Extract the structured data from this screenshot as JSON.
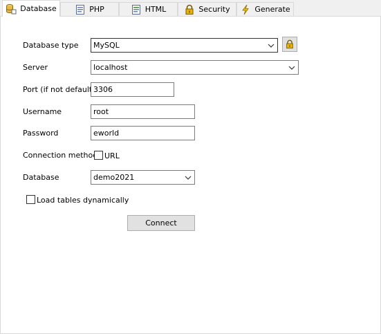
{
  "tabs": [
    {
      "label": "Database",
      "icon": "database-icon",
      "active": true
    },
    {
      "label": "PHP",
      "icon": "php-page-icon",
      "active": false
    },
    {
      "label": "HTML",
      "icon": "html-page-icon",
      "active": false
    },
    {
      "label": "Security",
      "icon": "lock-icon",
      "active": false
    },
    {
      "label": "Generate",
      "icon": "lightning-icon",
      "active": false
    }
  ],
  "form": {
    "database_type": {
      "label": "Database type",
      "value": "MySQL"
    },
    "server": {
      "label": "Server",
      "value": "localhost"
    },
    "port": {
      "label": "Port (if not default)",
      "value": "3306"
    },
    "username": {
      "label": "Username",
      "value": "root"
    },
    "password": {
      "label": "Password",
      "value": "eworld"
    },
    "connection_method": {
      "label": "Connection method",
      "url_label": "URL",
      "url_checked": false
    },
    "database": {
      "label": "Database",
      "value": "demo2021"
    },
    "load_tables": {
      "label": "Load tables dynamically",
      "checked": false
    },
    "connect_label": "Connect"
  },
  "colors": {
    "panel": "#ffffff",
    "background": "#f0f0f0",
    "lock": "#d8a300",
    "lightning": "#e0b000"
  }
}
